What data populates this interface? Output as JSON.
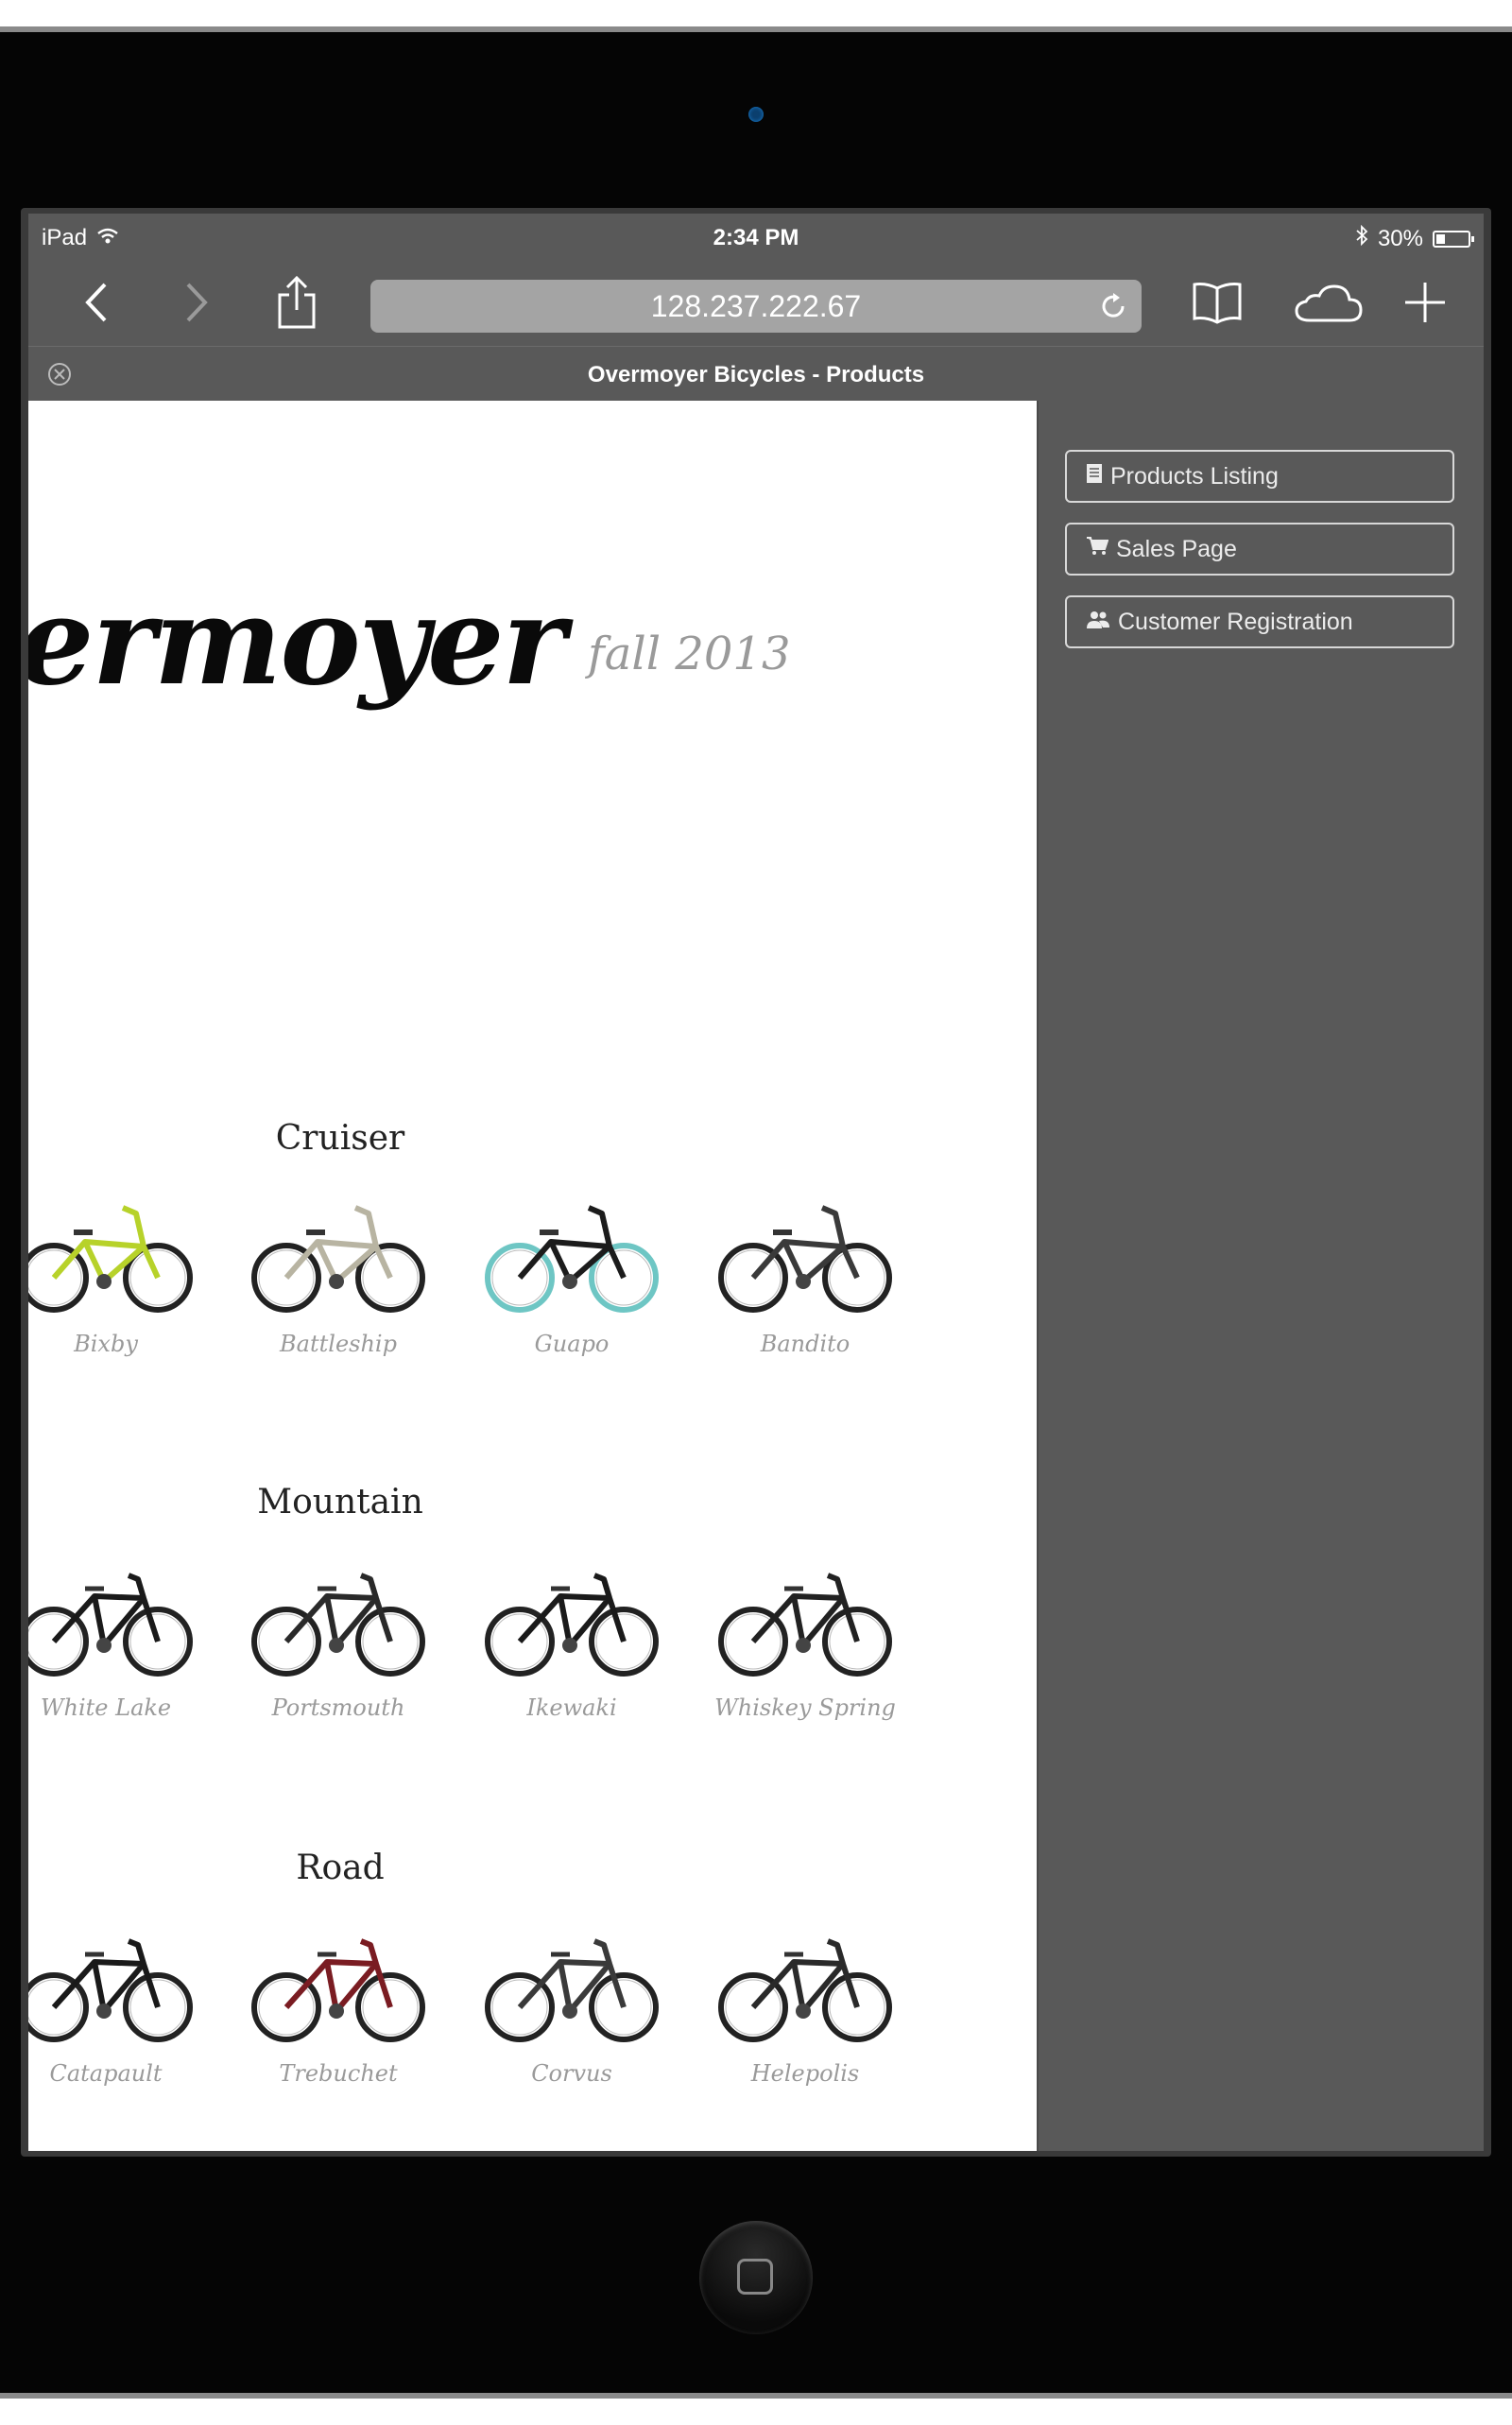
{
  "status_bar": {
    "device": "iPad",
    "time": "2:34 PM",
    "battery": "30%",
    "battery_level": 0.3
  },
  "browser": {
    "url": "128.237.222.67",
    "tab_title": "Overmoyer Bicycles - Products",
    "icons": [
      "back-icon",
      "forward-icon",
      "share-icon",
      "reload-icon",
      "bookmarks-icon",
      "cloud-tabs-icon",
      "new-tab-icon",
      "close-tab-icon"
    ]
  },
  "page": {
    "logo": "ermoyer",
    "season": "fall 2013",
    "sections": [
      {
        "title": "Cruiser",
        "bikes": [
          {
            "name": "Bixby",
            "color": "#b7d22a"
          },
          {
            "name": "Battleship",
            "color": "#b8b4a2"
          },
          {
            "name": "Guapo",
            "color": "#1c1c1c"
          },
          {
            "name": "Bandito",
            "color": "#3a3a3a"
          }
        ]
      },
      {
        "title": "Mountain",
        "bikes": [
          {
            "name": "White Lake",
            "color": "#1a1a1a"
          },
          {
            "name": "Portsmouth",
            "color": "#2a2a2a"
          },
          {
            "name": "Ikewaki",
            "color": "#1a1a1a"
          },
          {
            "name": "Whiskey Spring",
            "color": "#222222"
          }
        ]
      },
      {
        "title": "Road",
        "bikes": [
          {
            "name": "Catapault",
            "color": "#1a1a1a"
          },
          {
            "name": "Trebuchet",
            "color": "#7a1c22"
          },
          {
            "name": "Corvus",
            "color": "#3a3a3a"
          },
          {
            "name": "Helepolis",
            "color": "#2a2a2a"
          }
        ]
      }
    ]
  },
  "side_panel": {
    "buttons": [
      {
        "label": "Products Listing",
        "icon": "document-icon"
      },
      {
        "label": "Sales Page",
        "icon": "cart-icon"
      },
      {
        "label": "Customer Registration",
        "icon": "users-icon"
      }
    ]
  },
  "colors": {
    "chrome": "#595959",
    "url_field": "#a4a4a4",
    "caption": "#9a9a9a"
  }
}
